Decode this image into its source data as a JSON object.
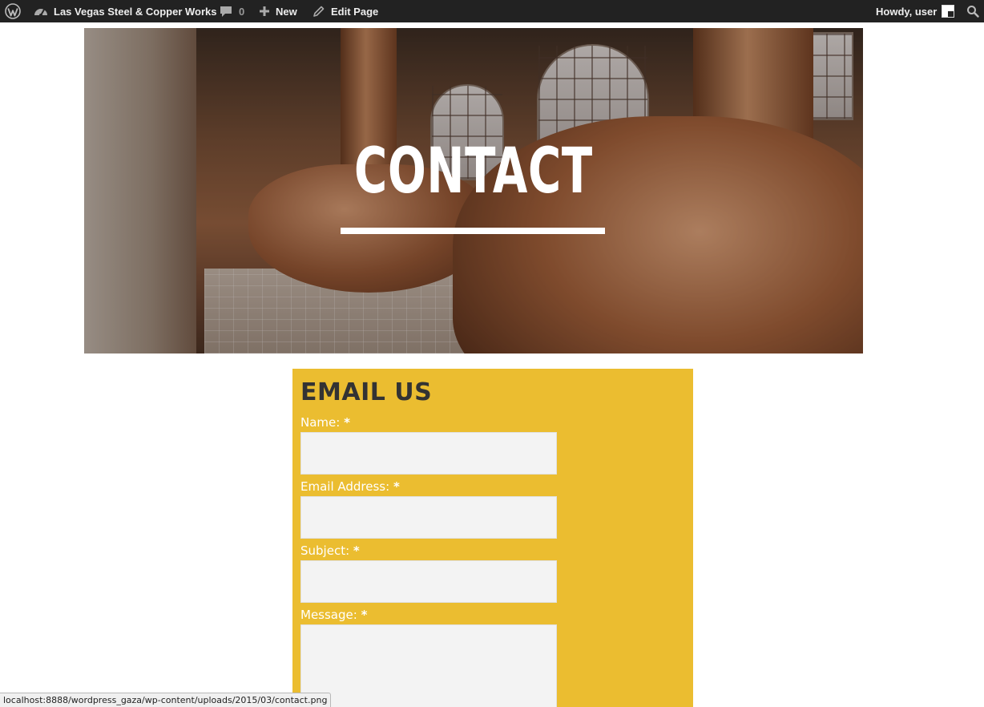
{
  "admin_bar": {
    "site_name": "Las Vegas Steel & Copper Works",
    "comment_count": "0",
    "new_label": "New",
    "edit_label": "Edit Page",
    "howdy": "Howdy, user"
  },
  "hero": {
    "title": "CONTACT"
  },
  "form": {
    "heading": "EMAIL US",
    "required_mark": "*",
    "fields": [
      {
        "label": "Name:",
        "value": ""
      },
      {
        "label": "Email Address:",
        "value": ""
      },
      {
        "label": "Subject:",
        "value": ""
      },
      {
        "label": "Message:",
        "value": ""
      }
    ]
  },
  "status_bar": {
    "url": "localhost:8888/wordpress_gaza/wp-content/uploads/2015/03/contact.png"
  },
  "colors": {
    "admin_bar_bg": "#222222",
    "form_bg": "#ebbd30",
    "input_bg": "#f3f3f3",
    "heading": "#333333"
  },
  "icons": [
    "wordpress-logo-icon",
    "dashboard-icon",
    "comment-icon",
    "plus-icon",
    "pencil-icon",
    "search-icon"
  ]
}
